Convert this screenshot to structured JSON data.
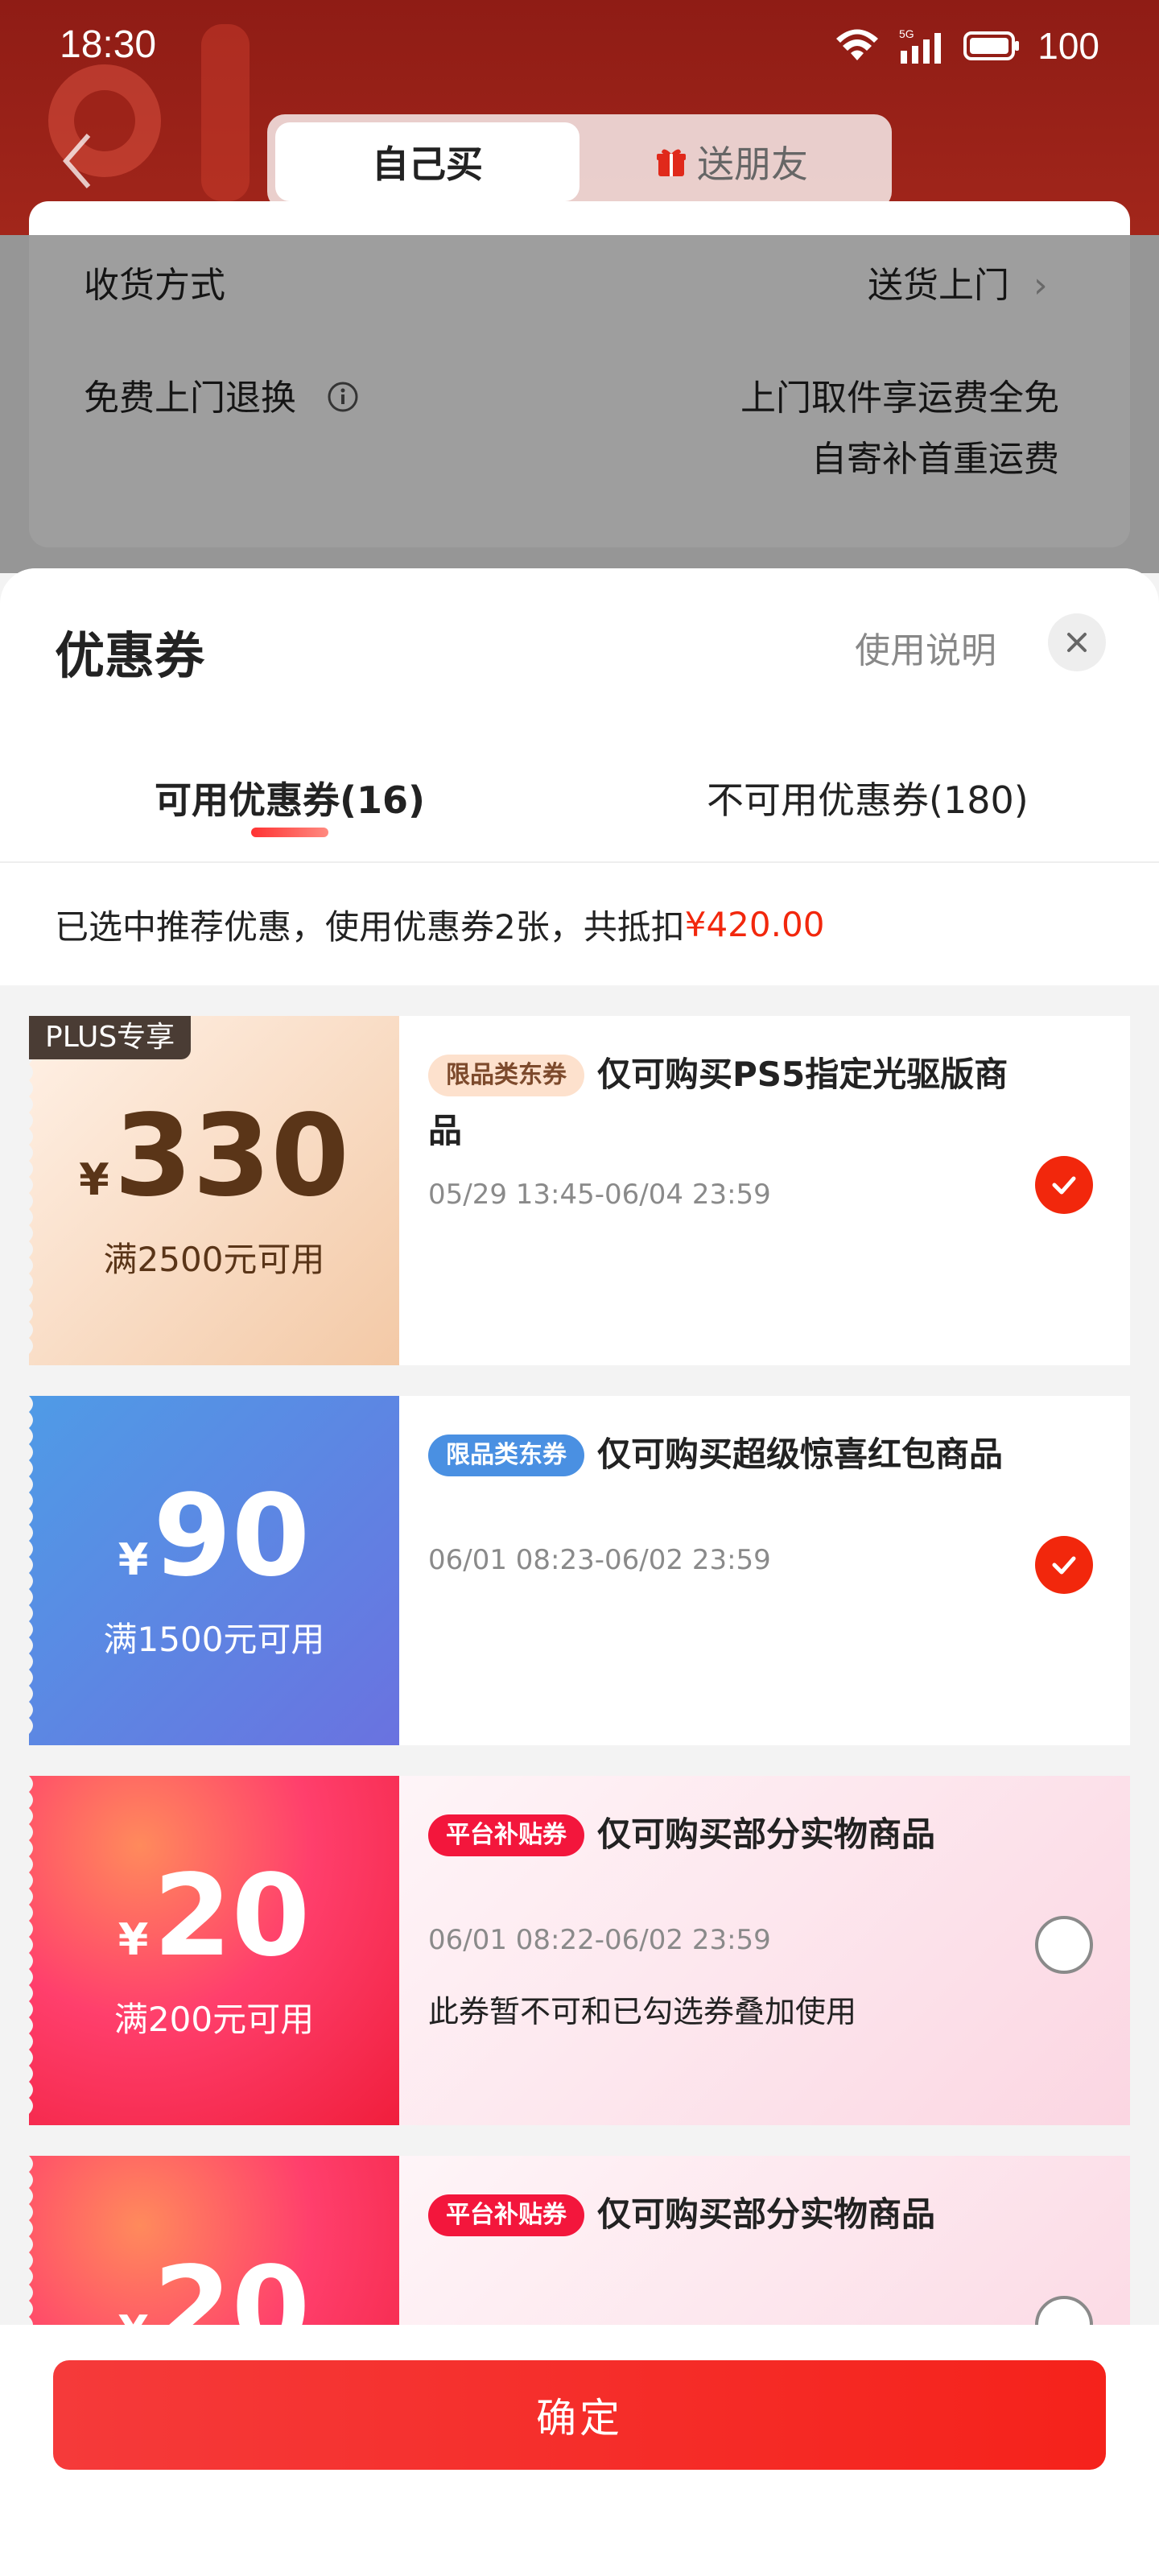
{
  "status_bar": {
    "time": "18:30",
    "network": "5G",
    "battery": "100"
  },
  "header": {
    "tabs": [
      {
        "label": "自己买",
        "active": true
      },
      {
        "label": "送朋友",
        "active": false
      }
    ]
  },
  "background_form": {
    "delivery_label": "收货方式",
    "delivery_value": "送货上门",
    "return_label": "免费上门退换",
    "return_value_line1": "上门取件享运费全免",
    "return_value_line2": "自寄补首重运费"
  },
  "sheet": {
    "title": "优惠券",
    "help_label": "使用说明",
    "tabs": [
      {
        "label": "可用优惠券(16)",
        "active": true
      },
      {
        "label": "不可用优惠券(180)",
        "active": false
      }
    ],
    "summary_prefix": "已选中推荐优惠，使用优惠券2张，共抵扣",
    "summary_amount": "¥420.00"
  },
  "coupons": [
    {
      "currency": "¥",
      "amount": "330",
      "condition": "满2500元可用",
      "badge": "PLUS专享",
      "tag": "限品类东券",
      "title": "仅可购买PS5指定光驱版商品",
      "date": "05/29 13:45-06/04 23:59",
      "note": "",
      "selected": true
    },
    {
      "currency": "¥",
      "amount": "90",
      "condition": "满1500元可用",
      "badge": "",
      "tag": "限品类东券",
      "title": "仅可购买超级惊喜红包商品",
      "date": "06/01 08:23-06/02 23:59",
      "note": "",
      "selected": true
    },
    {
      "currency": "¥",
      "amount": "20",
      "condition": "满200元可用",
      "badge": "",
      "tag": "平台补贴券",
      "title": "仅可购买部分实物商品",
      "date": "06/01 08:22-06/02 23:59",
      "note": "此券暂不可和已勾选券叠加使用",
      "selected": false
    },
    {
      "currency": "¥",
      "amount": "20",
      "condition": "",
      "badge": "",
      "tag": "平台补贴券",
      "title": "仅可购买部分实物商品",
      "date": "",
      "note": "",
      "selected": false
    }
  ],
  "confirm_label": "确定",
  "colors": {
    "accent_red": "#f2270c",
    "header_red": "#9e2219",
    "blue_coupon": "#4a90e2"
  }
}
